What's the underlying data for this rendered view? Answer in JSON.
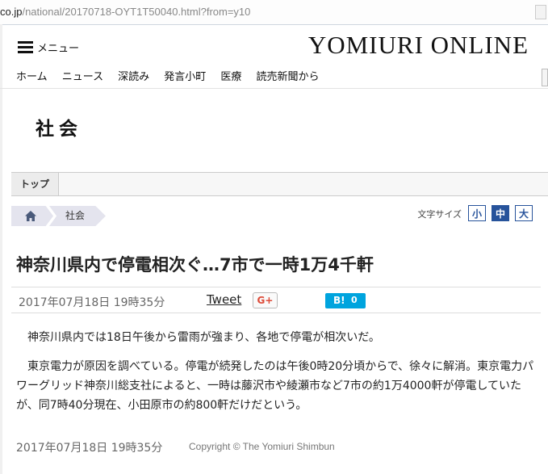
{
  "browser": {
    "url_host": "co.jp",
    "url_path": "/national/20170718-OYT1T50040.html?from=y10"
  },
  "header": {
    "menu_label": "メニュー",
    "logo": "YOMIURI ONLINE",
    "nav": [
      "ホーム",
      "ニュース",
      "深読み",
      "発言小町",
      "医療",
      "読売新聞から"
    ]
  },
  "section": {
    "title": "社会",
    "tab_top": "トップ"
  },
  "breadcrumb": {
    "home_icon": "home-icon",
    "section": "社会"
  },
  "font_size": {
    "label": "文字サイズ",
    "options": [
      "小",
      "中",
      "大"
    ],
    "selected": "中"
  },
  "article": {
    "headline": "神奈川県内で停電相次ぐ…7市で一時1万4千軒",
    "date": "2017年07月18日 19時35分",
    "share": {
      "tweet": "Tweet",
      "gplus": "G+",
      "hatena_label": "B!",
      "hatena_count": "0"
    },
    "paragraphs": [
      "神奈川県内では18日午後から雷雨が強まり、各地で停電が相次いだ。",
      "東京電力が原因を調べている。停電が続発したのは午後0時20分頃からで、徐々に解消。東京電力パワーグリッド神奈川総支社によると、一時は藤沢市や綾瀬市など7市の約1万4000軒が停電していたが、同7時40分現在、小田原市の約800軒だけだという。"
    ],
    "footer_date": "2017年07月18日 19時35分",
    "copyright": "Copyright © The Yomiuri Shimbun"
  },
  "colors": {
    "accent_blue": "#27539b",
    "hatena_blue": "#00a4de",
    "gplus_red": "#dd4b39",
    "breadcrumb_bg": "#e4e4ee"
  }
}
